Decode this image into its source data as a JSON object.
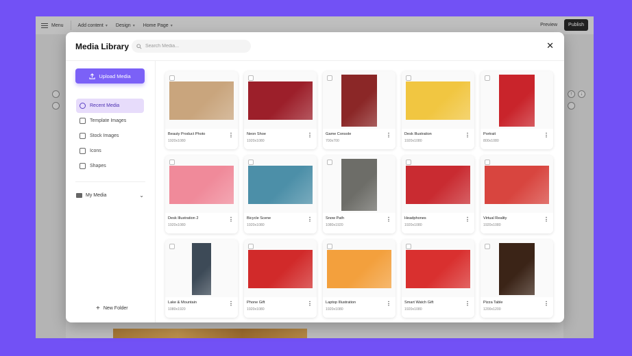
{
  "topbar": {
    "menu": "Menu",
    "add_content": "Add content",
    "design": "Design",
    "home_page": "Home Page",
    "preview": "Preview",
    "publish": "Publish"
  },
  "modal": {
    "title": "Media Library",
    "search_placeholder": "Search Media...",
    "close": "✕",
    "upload": "Upload Media",
    "nav": [
      {
        "label": "Recent Media",
        "icon": "clock-icon"
      },
      {
        "label": "Template Images",
        "icon": "template-icon"
      },
      {
        "label": "Stock Images",
        "icon": "image-icon"
      },
      {
        "label": "Icons",
        "icon": "icons-icon"
      },
      {
        "label": "Shapes",
        "icon": "shapes-icon"
      }
    ],
    "my_media": "My Media",
    "new_folder": "New Folder"
  },
  "media": [
    {
      "name": "Beauty Product Photo",
      "dims": "1920x1080",
      "color": "#c9a57d"
    },
    {
      "name": "Neon Shoe",
      "dims": "1920x1080",
      "color": "#9c1f2a"
    },
    {
      "name": "Game Console",
      "dims": "700x700",
      "color": "#8b2727"
    },
    {
      "name": "Desk Illustration",
      "dims": "1920x1080",
      "color": "#f1c641"
    },
    {
      "name": "Portrait",
      "dims": "800x1080",
      "color": "#c9242b"
    },
    {
      "name": "Desk Illustration 2",
      "dims": "1920x1080",
      "color": "#f08a9a"
    },
    {
      "name": "Bicycle Scene",
      "dims": "1920x1080",
      "color": "#4c8fa8"
    },
    {
      "name": "Snow Path",
      "dims": "1080x1920",
      "color": "#6d6d68"
    },
    {
      "name": "Headphones",
      "dims": "1920x1080",
      "color": "#c92b31"
    },
    {
      "name": "Virtual Reality",
      "dims": "1920x1080",
      "color": "#d8453f"
    },
    {
      "name": "Lake & Mountain",
      "dims": "1080x1920",
      "color": "#3d4a57"
    },
    {
      "name": "Phone Gift",
      "dims": "1920x1080",
      "color": "#d12a2a"
    },
    {
      "name": "Laptop Illustration",
      "dims": "1920x1080",
      "color": "#f3a03d"
    },
    {
      "name": "Smart Watch Gift",
      "dims": "1920x1080",
      "color": "#d9302f"
    },
    {
      "name": "Pizza Table",
      "dims": "1200x1200",
      "color": "#3b2417"
    }
  ]
}
